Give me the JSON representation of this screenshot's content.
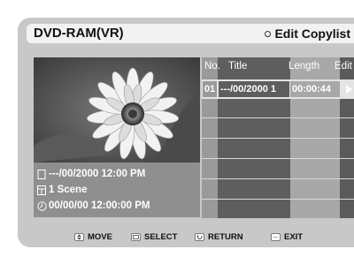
{
  "header": {
    "title": "DVD-RAM(VR)",
    "mode_label": "Edit Copylist"
  },
  "thumbnail": {
    "description_icon": "flower-thumbnail"
  },
  "info": {
    "date": "---/00/2000 12:00 PM",
    "scenes": "1 Scene",
    "duration": "00/00/00 12:00:00 PM"
  },
  "table": {
    "headers": {
      "no": "No.",
      "title": "Title",
      "length": "Length",
      "edit": "Edit"
    },
    "rows": [
      {
        "no": "01",
        "title": "---/00/2000 1",
        "length": "00:00:44"
      }
    ]
  },
  "footer": {
    "move": "MOVE",
    "select": "SELECT",
    "return": "RETURN",
    "exit": "EXIT"
  },
  "colors": {
    "frame": "#c8c8c8",
    "no_col": "#9a9a9a",
    "title_col": "#5e5e5e",
    "length_col": "#a8a8a8",
    "edit_col": "#5a5a5a",
    "info_bg": "#8f8f8f"
  }
}
